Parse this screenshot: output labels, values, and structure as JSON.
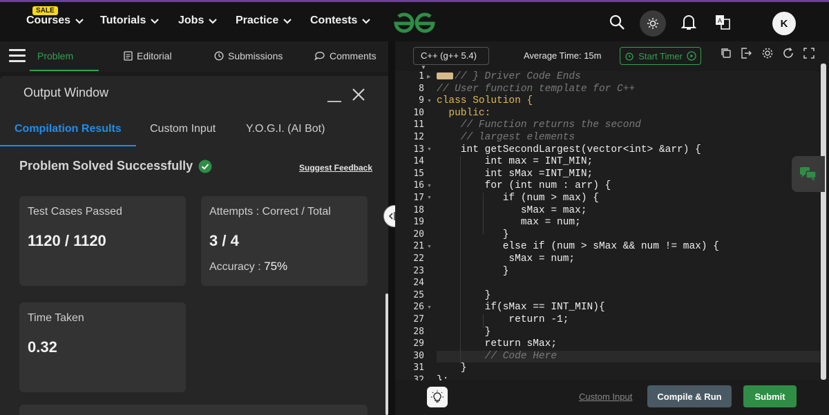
{
  "nav": {
    "sale_badge": "SALE",
    "items": [
      {
        "label": "Courses"
      },
      {
        "label": "Tutorials"
      },
      {
        "label": "Jobs"
      },
      {
        "label": "Practice"
      },
      {
        "label": "Contests"
      }
    ],
    "logo_icon": "gfg-logo-icon",
    "avatar_initial": "K",
    "brand_color": "#2f8d46"
  },
  "problem_tabs": {
    "items": [
      {
        "label": "Problem"
      },
      {
        "label": "Editorial"
      },
      {
        "label": "Submissions"
      },
      {
        "label": "Comments"
      }
    ]
  },
  "output_window": {
    "title": "Output Window",
    "tabs": [
      {
        "label": "Compilation Results"
      },
      {
        "label": "Custom Input"
      },
      {
        "label": "Y.O.G.I. (AI Bot)"
      }
    ],
    "status": "Problem Solved Successfully",
    "suggest_feedback": "Suggest Feedback",
    "cards": {
      "test_cases": {
        "label": "Test Cases Passed",
        "value": "1120 / 1120"
      },
      "attempts": {
        "label": "Attempts : Correct / Total",
        "value": "3 / 4",
        "accuracy_label": "Accuracy :",
        "accuracy_value": "75%"
      },
      "time": {
        "label": "Time Taken",
        "value": "0.32"
      }
    }
  },
  "editor": {
    "language": "C++ (g++ 5.4)",
    "average_time": "Average Time: 15m",
    "start_timer": "Start Timer",
    "line_numbers": [
      "1",
      "8",
      "9",
      "10",
      "11",
      "12",
      "13",
      "14",
      "15",
      "16",
      "17",
      "18",
      "19",
      "20",
      "21",
      "22",
      "23",
      "24",
      "25",
      "26",
      "27",
      "28",
      "29",
      "30",
      "31",
      "32"
    ],
    "code_lines": [
      "// } Driver Code Ends",
      "// User function template for C++",
      "class Solution {",
      "  public:",
      "    // Function returns the second",
      "    // largest elements",
      "    int getSecondLargest(vector<int> &arr) {",
      "        int max = INT_MIN;",
      "        int sMax =INT_MIN;",
      "        for (int num : arr) {",
      "           if (num > max) {",
      "              sMax = max;",
      "              max = num;",
      "           }",
      "           else if (num > sMax && num != max) {",
      "            sMax = num;",
      "           }",
      "",
      "        }",
      "        if(sMax == INT_MIN){",
      "            return -1;",
      "        }",
      "        return sMax;",
      "        // Code Here",
      "    }",
      "};"
    ],
    "custom_input": "Custom Input",
    "compile_run": "Compile & Run",
    "submit": "Submit"
  }
}
